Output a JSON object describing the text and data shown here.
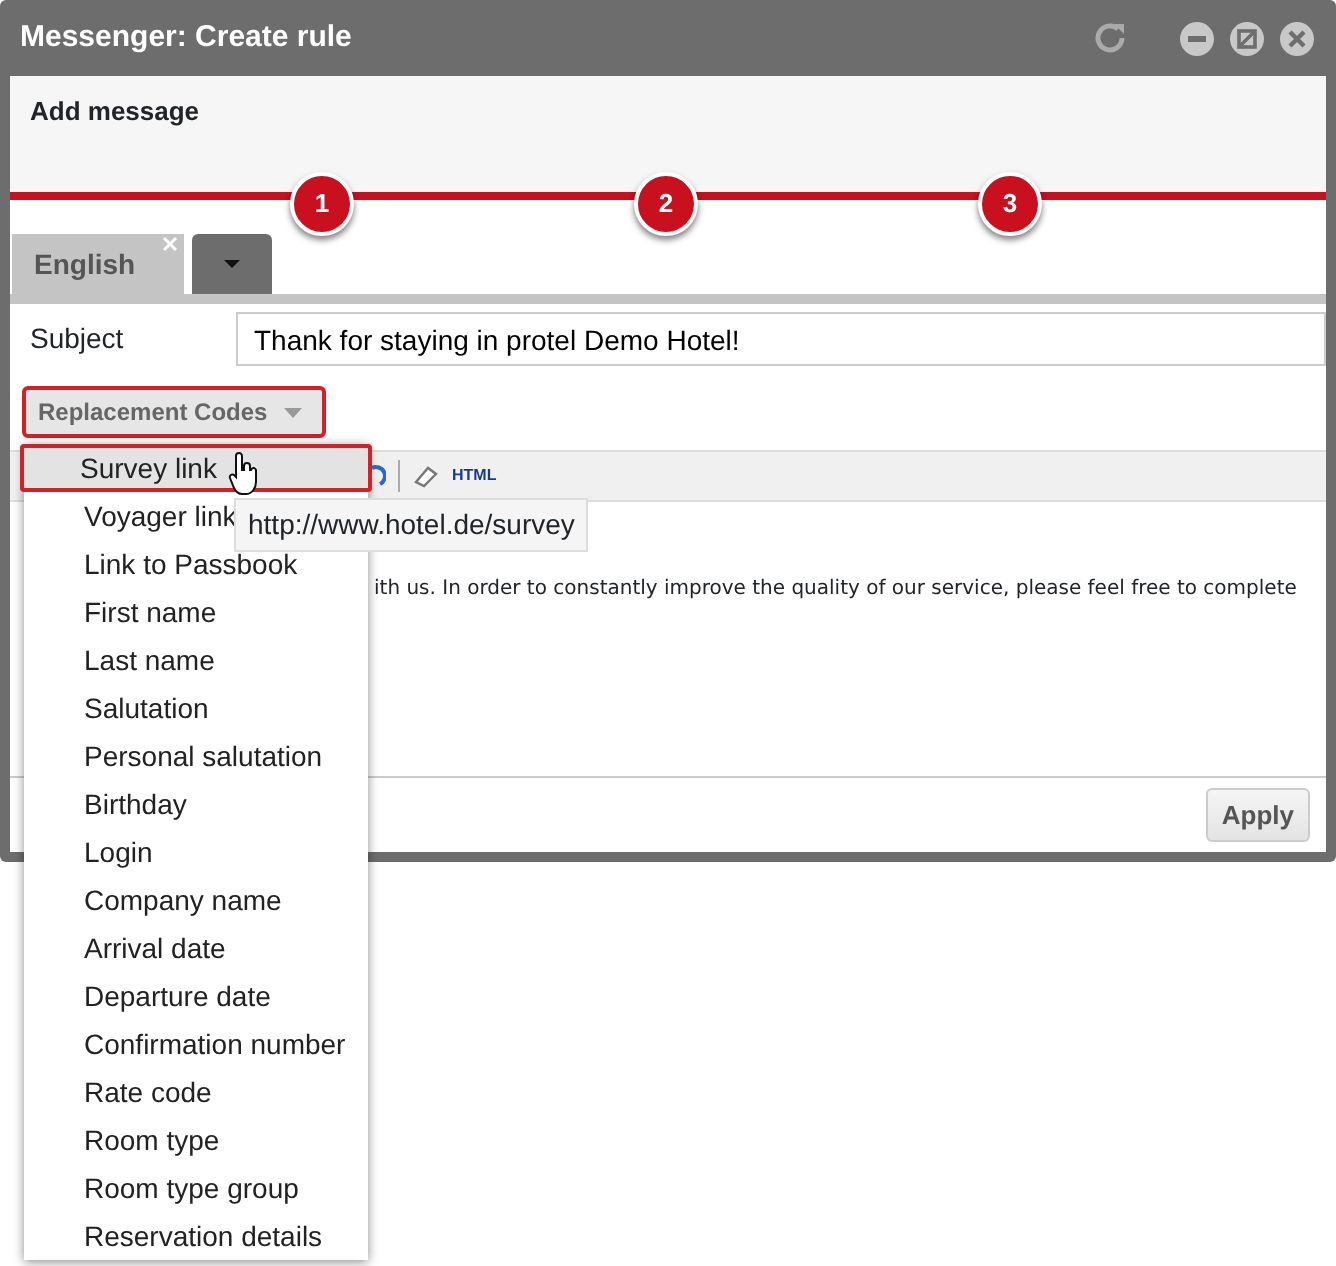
{
  "window": {
    "title": "Messenger: Create rule"
  },
  "header": {
    "title": "Add message",
    "steps": [
      {
        "label": "1"
      },
      {
        "label": "2"
      },
      {
        "label": "3"
      }
    ]
  },
  "language_tab": {
    "label": "English",
    "selected": true
  },
  "subject": {
    "label": "Subject",
    "value": "Thank for staying in protel Demo Hotel!"
  },
  "replacement_codes": {
    "label": "Replacement Codes",
    "expanded": true,
    "items": [
      {
        "label": "Survey link",
        "selected": true
      },
      {
        "label": "Voyager link",
        "selected": false
      },
      {
        "label": "Link to Passbook",
        "selected": false
      },
      {
        "label": "First name",
        "selected": false
      },
      {
        "label": "Last name",
        "selected": false
      },
      {
        "label": "Salutation",
        "selected": false
      },
      {
        "label": "Personal salutation",
        "selected": false
      },
      {
        "label": "Birthday",
        "selected": false
      },
      {
        "label": "Login",
        "selected": false
      },
      {
        "label": "Company name",
        "selected": false
      },
      {
        "label": "Arrival date",
        "selected": false
      },
      {
        "label": "Departure date",
        "selected": false
      },
      {
        "label": "Confirmation number",
        "selected": false
      },
      {
        "label": "Rate code",
        "selected": false
      },
      {
        "label": "Room type",
        "selected": false
      },
      {
        "label": "Room type group",
        "selected": false
      },
      {
        "label": "Reservation details",
        "selected": false
      }
    ]
  },
  "tooltip": "http://www.hotel.de/survey",
  "editor": {
    "toolbar_html": "HTML",
    "text": "ith us. In order to constantly improve the quality of our service, please feel free to complete"
  },
  "footer": {
    "apply": "Apply"
  }
}
